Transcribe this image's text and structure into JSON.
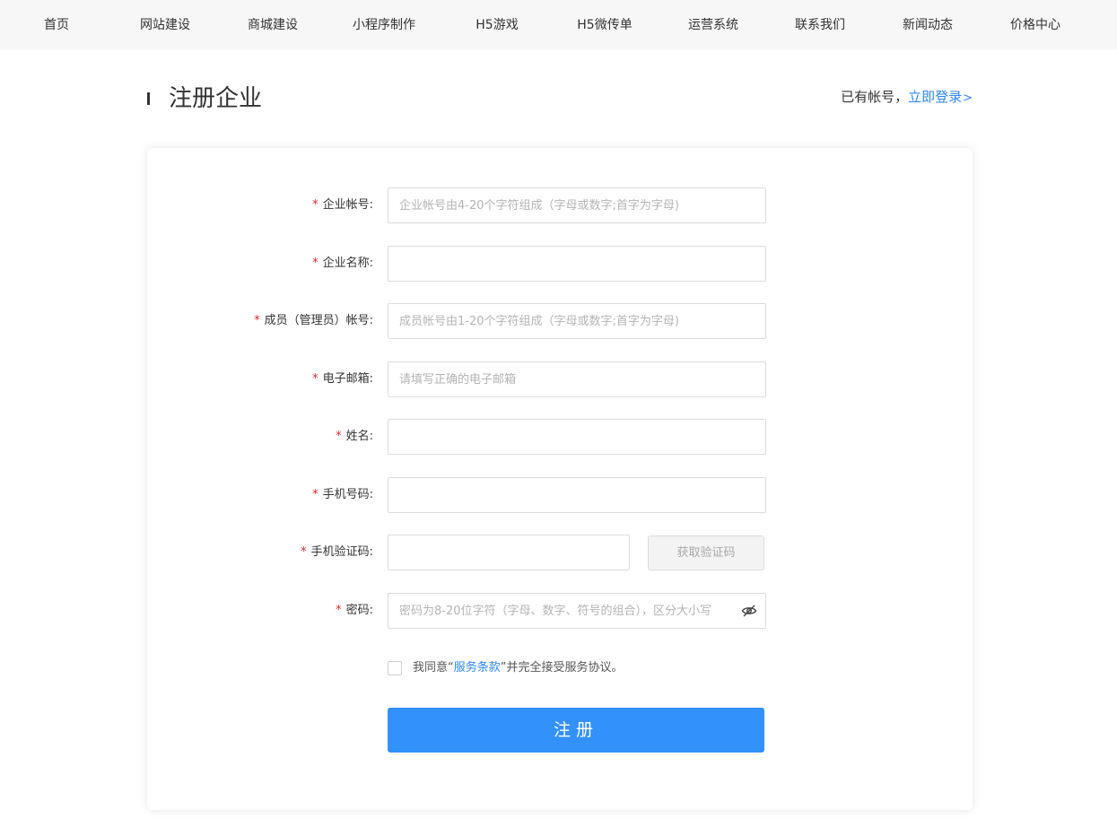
{
  "nav": {
    "items": [
      {
        "label": "首页"
      },
      {
        "label": "网站建设"
      },
      {
        "label": "商城建设"
      },
      {
        "label": "小程序制作"
      },
      {
        "label": "H5游戏"
      },
      {
        "label": "H5微传单"
      },
      {
        "label": "运营系统"
      },
      {
        "label": "联系我们"
      },
      {
        "label": "新闻动态"
      },
      {
        "label": "价格中心"
      }
    ]
  },
  "header": {
    "title": "注册企业",
    "has_account_text": "已有帐号，",
    "login_link": "立即登录",
    "login_arrow": ">"
  },
  "form": {
    "required_mark": "*",
    "fields": [
      {
        "label": "企业帐号:",
        "value": "",
        "placeholder": "企业帐号由4-20个字符组成（字母或数字;首字为字母)"
      },
      {
        "label": "企业名称:",
        "value": "",
        "placeholder": ""
      },
      {
        "label": "成员（管理员）帐号:",
        "value": "",
        "placeholder": "成员帐号由1-20个字符组成（字母或数字;首字为字母)"
      },
      {
        "label": "电子邮箱:",
        "value": "",
        "placeholder": "请填写正确的电子邮箱"
      },
      {
        "label": "姓名:",
        "value": "",
        "placeholder": ""
      },
      {
        "label": "手机号码:",
        "value": "",
        "placeholder": ""
      },
      {
        "label": "手机验证码:",
        "value": "",
        "placeholder": ""
      },
      {
        "label": "密码:",
        "value": "",
        "placeholder": "密码为8-20位字符（字母、数字、符号的组合），区分大小写"
      }
    ],
    "get_code_button": "获取验证码",
    "password_toggle_icon": "eye-off-icon",
    "agree": {
      "checked": false,
      "prefix": "我同意“",
      "terms_link": "服务条款",
      "suffix": "”并完全接受服务协议。"
    },
    "submit_label": "注册"
  },
  "colors": {
    "accent": "#3391fb",
    "link": "#2f86f5",
    "required": "#e0282e",
    "nav_bg": "#f7f7f7"
  }
}
